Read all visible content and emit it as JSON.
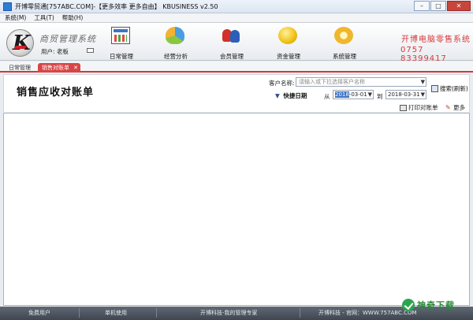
{
  "window": {
    "title": "开博零贸通[757ABC.COM]-【更多效率 更多自由】 KBUSINESS v2.50",
    "minimize": "–",
    "maximize": "□",
    "close": "✕"
  },
  "menu": [
    "系统(M)",
    "工具(T)",
    "帮助(H)"
  ],
  "header": {
    "system_name": "商贸管理系统",
    "user_label": "用户: 老板",
    "nav": [
      {
        "label": "日常管理",
        "icon": "daily-icon"
      },
      {
        "label": "经营分析",
        "icon": "analysis-icon"
      },
      {
        "label": "会员管理",
        "icon": "member-icon"
      },
      {
        "label": "资金管理",
        "icon": "fund-icon"
      },
      {
        "label": "系统管理",
        "icon": "system-gear-icon"
      }
    ],
    "hotline_title": "开博电脑零售系统",
    "hotline_number": "0757 83399417"
  },
  "tabs": {
    "home": "日常管理",
    "active": "销售对账单",
    "active_close": "✕"
  },
  "toolbar": {
    "page_title": "销售应收对账单",
    "customer_label": "客户名称:",
    "customer_placeholder": "请输入或下拉选择客户名称",
    "search_label": "搜索(刷新)",
    "quick_date_label": "快捷日期",
    "from_label": "从",
    "date_from_selected": "2018",
    "date_from_rest": "-03-01",
    "to_label": "到",
    "date_to": "2018-03-31",
    "print_label": "打印对账单",
    "more_label": "更多"
  },
  "status": {
    "free_user": "免费用户",
    "single_use": "单机使用",
    "vendor_tagline": "开博科技-我的管理专家",
    "vendor_site": "开博科技 - 官网：WWW.757ABC.COM"
  },
  "watermark": {
    "text": "神奇下载"
  }
}
